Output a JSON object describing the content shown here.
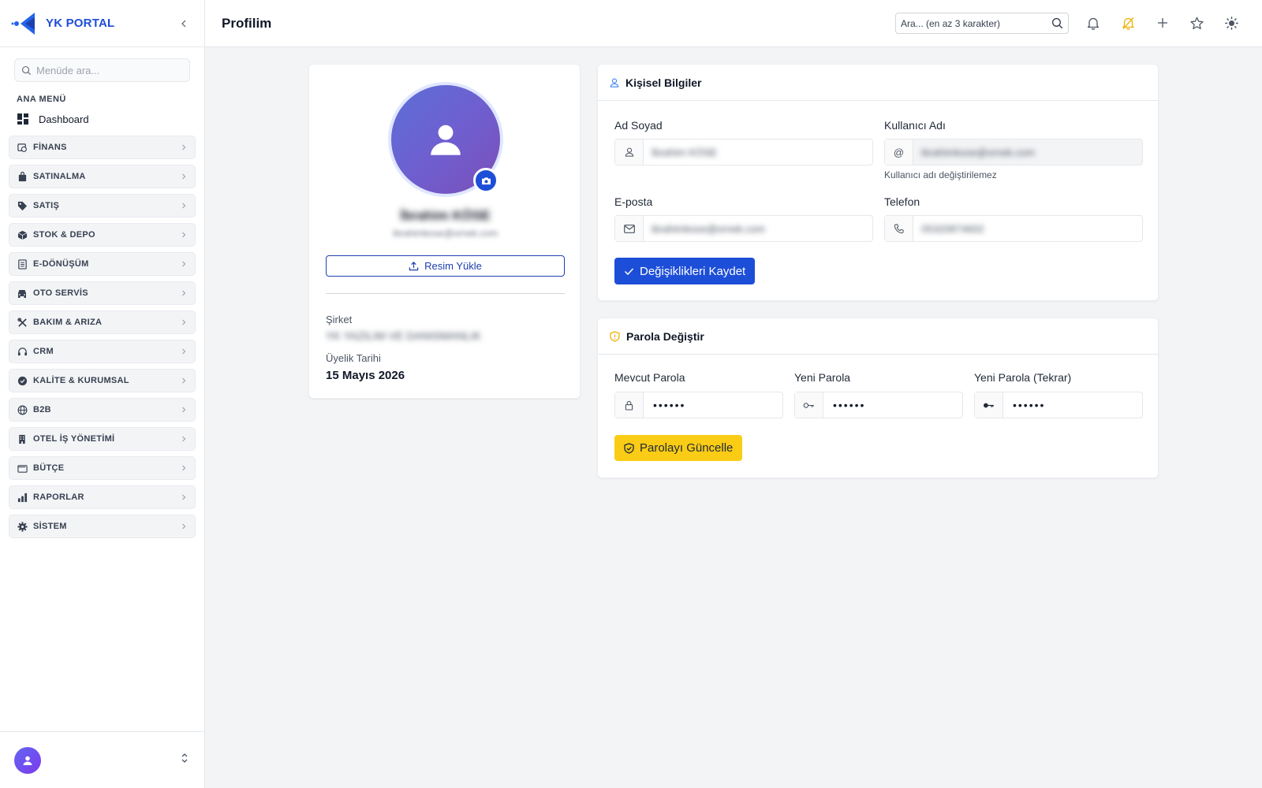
{
  "brand": {
    "name": "YK PORTAL"
  },
  "sidebar": {
    "search_placeholder": "Menüde ara...",
    "section_title": "ANA MENÜ",
    "dashboard_label": "Dashboard",
    "items": [
      {
        "label": "FİNANS",
        "icon": "finance-icon"
      },
      {
        "label": "SATINALMA",
        "icon": "shopping-bag-icon"
      },
      {
        "label": "SATIŞ",
        "icon": "tag-icon"
      },
      {
        "label": "STOK & DEPO",
        "icon": "box-icon"
      },
      {
        "label": "E-DÖNÜŞÜM",
        "icon": "document-icon"
      },
      {
        "label": "OTO SERVİS",
        "icon": "car-icon"
      },
      {
        "label": "BAKIM & ARIZA",
        "icon": "tools-icon"
      },
      {
        "label": "CRM",
        "icon": "headset-icon"
      },
      {
        "label": "KALİTE & KURUMSAL",
        "icon": "badge-check-icon"
      },
      {
        "label": "B2B",
        "icon": "globe-icon"
      },
      {
        "label": "OTEL İŞ YÖNETİMİ",
        "icon": "building-icon"
      },
      {
        "label": "BÜTÇE",
        "icon": "wallet-icon"
      },
      {
        "label": "RAPORLAR",
        "icon": "bar-chart-icon"
      },
      {
        "label": "SİSTEM",
        "icon": "gear-icon"
      }
    ]
  },
  "header": {
    "title": "Profilim",
    "search_placeholder": "Ara... (en az 3 karakter)"
  },
  "profile": {
    "name": "İbrahim KÖSE",
    "email": "ibrahimkose@ornek.com",
    "upload_label": "Resim Yükle",
    "company_label": "Şirket",
    "company_value": "YK YAZILIM VE DANISMANLIK",
    "member_since_label": "Üyelik Tarihi",
    "member_since_value": "15 Mayıs 2026"
  },
  "personal_info": {
    "title": "Kişisel Bilgiler",
    "fullname_label": "Ad Soyad",
    "fullname_value": "İbrahim KÖSE",
    "username_label": "Kullanıcı Adı",
    "username_prefix": "@",
    "username_value": "ibrahimkose@ornek.com",
    "username_hint": "Kullanıcı adı değiştirilemez",
    "email_label": "E-posta",
    "email_value": "ibrahimkose@ornek.com",
    "phone_label": "Telefon",
    "phone_value": "05320874602",
    "save_label": "Değişiklikleri Kaydet"
  },
  "password": {
    "title": "Parola Değiştir",
    "current_label": "Mevcut Parola",
    "new_label": "Yeni Parola",
    "confirm_label": "Yeni Parola (Tekrar)",
    "mask": "••••••",
    "update_label": "Parolayı Güncelle"
  },
  "colors": {
    "primary": "#1d4ed8",
    "warning": "#facc15",
    "avatar_start": "#5b6fd8",
    "avatar_end": "#7a4fb8"
  }
}
